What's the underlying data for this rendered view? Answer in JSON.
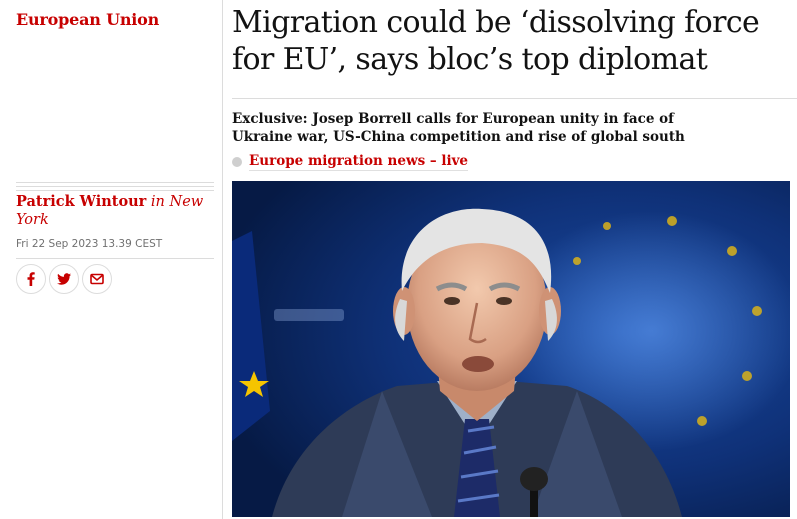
{
  "section": {
    "label": "European Union"
  },
  "article": {
    "headline": "Migration could be ‘dissolving force for EU’, says bloc’s top diplomat",
    "standfirst": "Exclusive: Josep Borrell calls for European unity in face of Ukraine war, US-China competition and rise of global south",
    "live_link": "Europe migration news – live"
  },
  "byline": {
    "author": "Patrick Wintour",
    "location": "in New York",
    "dateline": "Fri 22 Sep 2023 13.39 CEST"
  },
  "share": [
    {
      "icon": "facebook-icon"
    },
    {
      "icon": "twitter-icon"
    },
    {
      "icon": "email-icon"
    }
  ],
  "colors": {
    "accent": "#c70000",
    "text": "#121212",
    "muted": "#707070",
    "rule": "#dcdcdc",
    "photo_background": "#0d2f6e"
  }
}
